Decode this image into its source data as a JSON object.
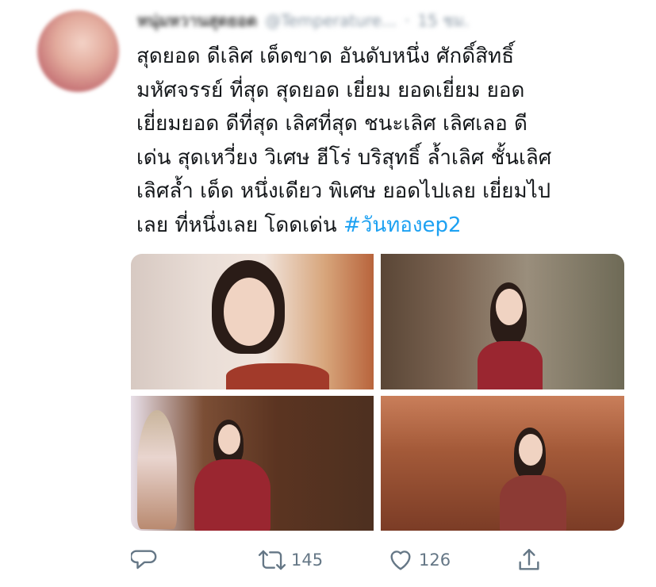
{
  "header": {
    "name": "หนุ่มหวานสุดยอด",
    "handle": "@Temperature...",
    "separator": "·",
    "time": "15 ชม."
  },
  "tweet": {
    "lines": [
      "สุดยอด ดีเลิศ เด็ดขาด อันดับหนึ่ง ศักดิ์สิทธิ์",
      "มหัศจรรย์ ที่สุด สุดยอด เยี่ยม ยอดเยี่ยม ยอด",
      "เยี่ยมยอด ดีที่สุด เลิศที่สุด ชนะเลิศ เลิศเลอ ดี",
      "เด่น สุดเหวี่ยง วิเศษ ฮีโร่ บริสุทธิ์ ล้ำเลิศ ชั้นเลิศ",
      "เลิศล้ำ เด็ด หนึ่งเดียว พิเศษ ยอดไปเลย เยี่ยมไป"
    ],
    "last_line_text": "เลย ที่หนึ่งเลย โดดเด่น ",
    "hashtag": "#วันทองep2"
  },
  "media": {
    "photos": [
      "photo-1",
      "photo-2",
      "photo-3",
      "photo-4"
    ]
  },
  "actions": {
    "reply": {
      "icon": "reply-icon",
      "count": ""
    },
    "retweet": {
      "icon": "retweet-icon",
      "count": "145"
    },
    "like": {
      "icon": "heart-icon",
      "count": "126"
    },
    "share": {
      "icon": "share-icon",
      "count": ""
    }
  },
  "colors": {
    "text": "#14171a",
    "secondary": "#657786",
    "accent": "#1da1f2"
  }
}
